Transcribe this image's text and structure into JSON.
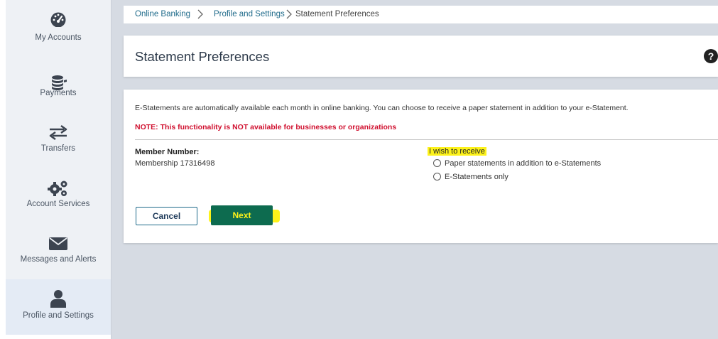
{
  "sidebar": {
    "items": [
      {
        "label": "My Accounts",
        "icon": "speedometer-icon"
      },
      {
        "label": "Payments",
        "icon": "coins-icon"
      },
      {
        "label": "Transfers",
        "icon": "transfer-arrows-icon"
      },
      {
        "label": "Account Services",
        "icon": "gears-icon"
      },
      {
        "label": "Messages and Alerts",
        "icon": "envelope-icon"
      },
      {
        "label": "Profile and Settings",
        "icon": "person-icon",
        "active": true
      }
    ]
  },
  "breadcrumb": [
    "Online Banking",
    "Profile and Settings",
    "Statement Preferences"
  ],
  "page": {
    "title": "Statement Preferences",
    "help_icon": "?"
  },
  "content": {
    "intro": "E-Statements are automatically available each month in online banking. You can choose to receive a paper statement in addition to your e-Statement.",
    "note": "NOTE: This functionality is NOT available for businesses or organizations",
    "member_label": "Member Number:",
    "member_value": "Membership 17316498",
    "wish_label": "I wish to receive",
    "options": [
      "Paper statements in addition to e-Statements",
      "E-Statements only"
    ]
  },
  "buttons": {
    "cancel": "Cancel",
    "next": "Next"
  },
  "colors": {
    "accent_link": "#1e6a8a",
    "note_red": "#d0102f",
    "next_green": "#0d6b4f",
    "highlight_yellow": "#fdf21a"
  }
}
